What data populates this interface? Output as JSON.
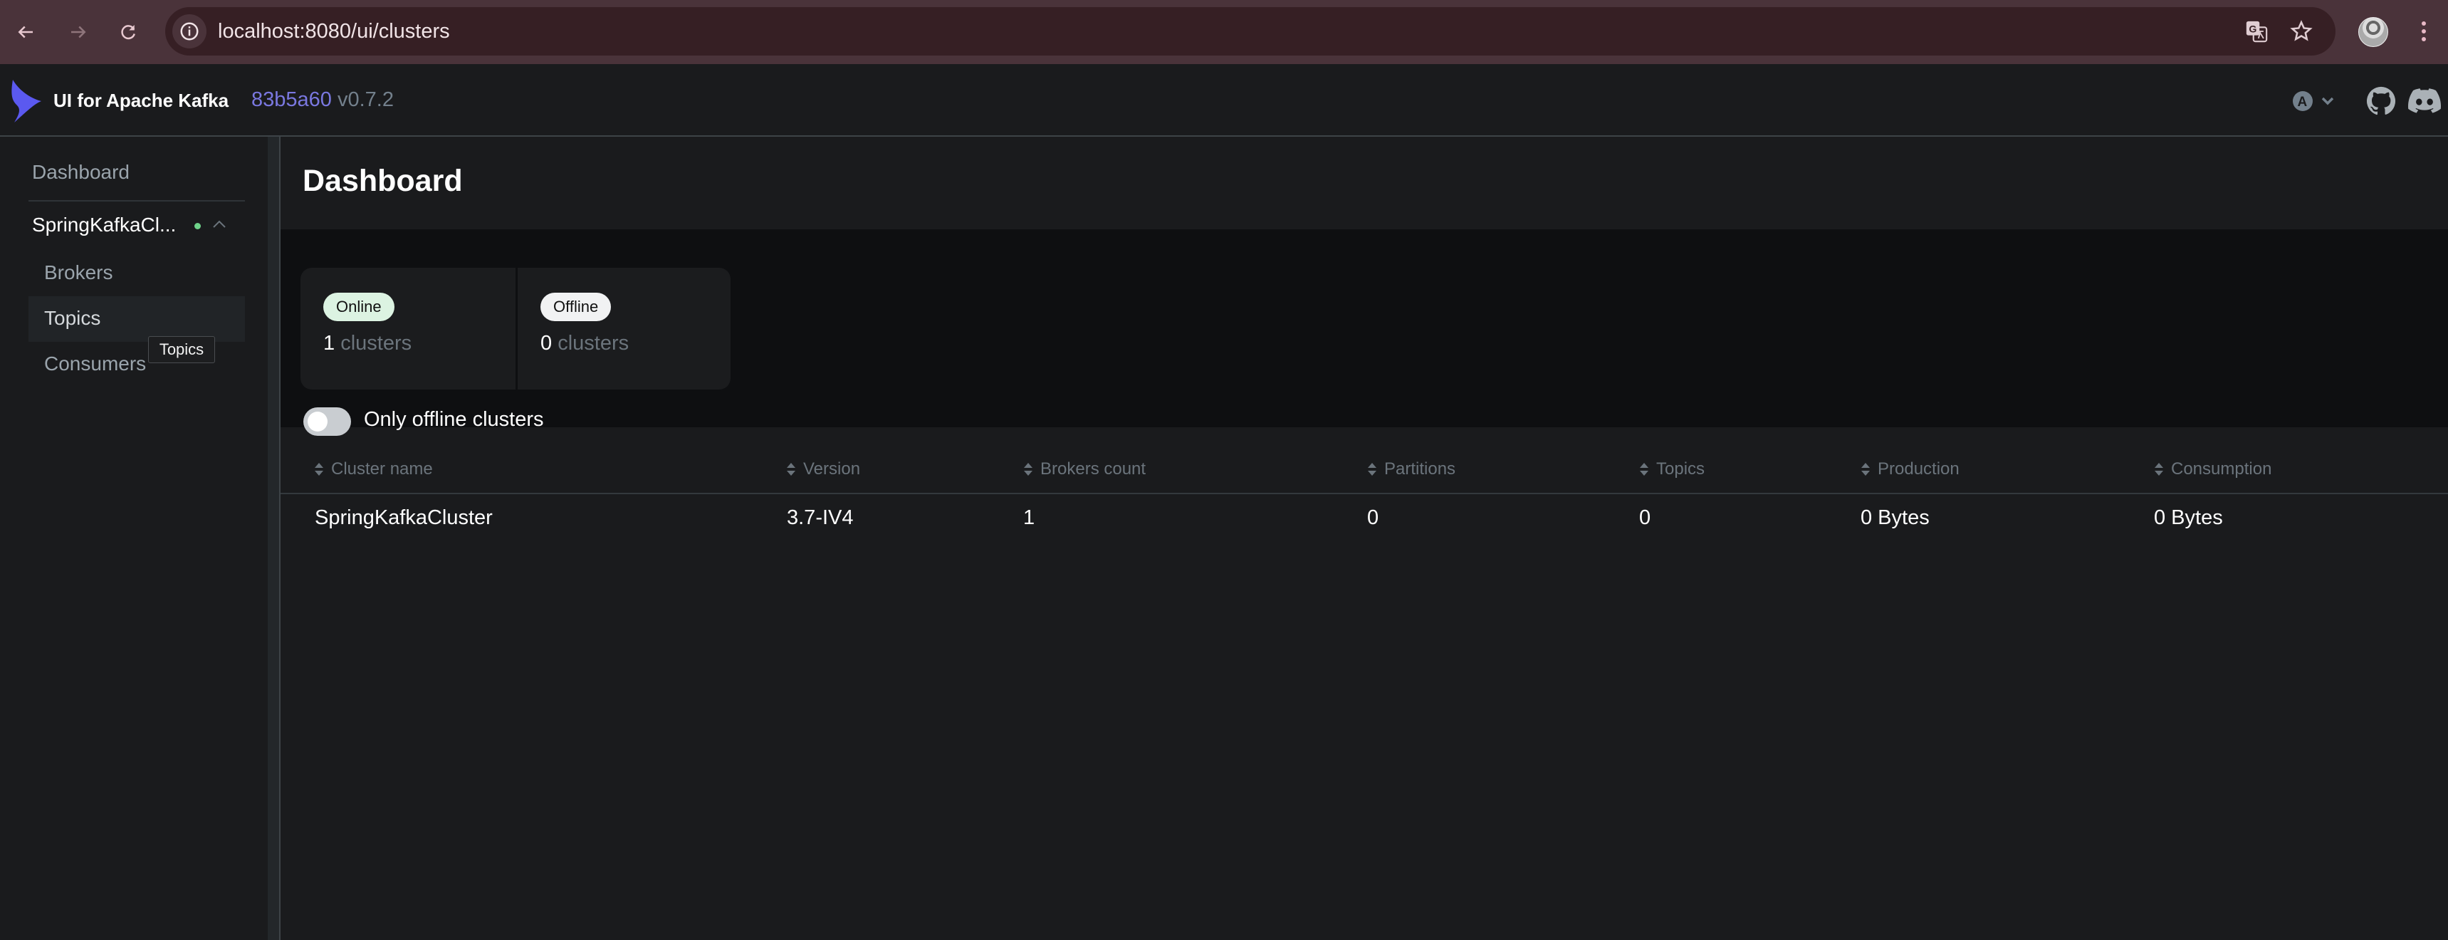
{
  "browser": {
    "url": "localhost:8080/ui/clusters",
    "icons": [
      "back-arrow-icon",
      "forward-arrow-icon",
      "reload-icon",
      "site-info-icon",
      "translate-icon",
      "bookmark-star-icon",
      "profile-avatar",
      "more-menu-icon"
    ]
  },
  "header": {
    "app_title": "UI for Apache Kafka",
    "commit_hash": "83b5a60",
    "version": "v0.7.2",
    "icons": [
      "theme-auto-icon",
      "chevron-down-icon",
      "github-icon",
      "discord-icon"
    ],
    "brand_color": "#5b59f0"
  },
  "sidebar": {
    "dashboard_label": "Dashboard",
    "cluster": {
      "name": "SpringKafkaCl...",
      "status_color": "#6fd38a",
      "expanded": true,
      "items": [
        {
          "label": "Brokers"
        },
        {
          "label": "Topics",
          "hovered": true
        },
        {
          "label": "Consumers"
        }
      ]
    },
    "tooltip": "Topics"
  },
  "main": {
    "title": "Dashboard",
    "metrics": [
      {
        "badge": "Online",
        "count": "1",
        "unit": "clusters"
      },
      {
        "badge": "Offline",
        "count": "0",
        "unit": "clusters"
      }
    ],
    "filter_toggle": {
      "label": "Only offline clusters",
      "checked": false
    },
    "table": {
      "columns": [
        "Cluster name",
        "Version",
        "Brokers count",
        "Partitions",
        "Topics",
        "Production",
        "Consumption"
      ],
      "rows": [
        [
          "SpringKafkaCluster",
          "3.7-IV4",
          "1",
          "0",
          "0",
          "0 Bytes",
          "0 Bytes"
        ]
      ]
    }
  }
}
